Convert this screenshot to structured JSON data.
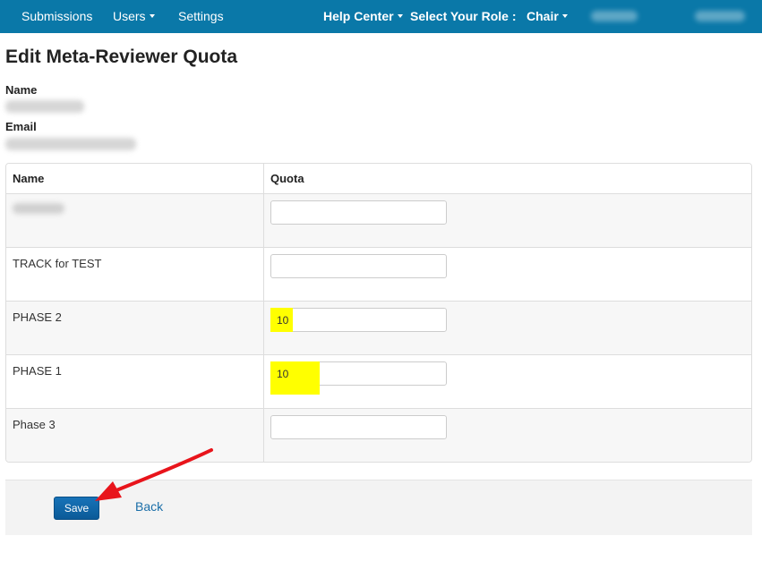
{
  "navbar": {
    "submissions": "Submissions",
    "users": "Users",
    "settings": "Settings",
    "help_center": "Help Center",
    "select_role_label": "Select Your Role :",
    "role": "Chair"
  },
  "page": {
    "title": "Edit Meta-Reviewer Quota",
    "name_label": "Name",
    "email_label": "Email"
  },
  "table": {
    "headers": {
      "name": "Name",
      "quota": "Quota"
    },
    "rows": [
      {
        "name": "",
        "quota": ""
      },
      {
        "name": "TRACK for TEST",
        "quota": ""
      },
      {
        "name": "PHASE 2",
        "quota": "10"
      },
      {
        "name": "PHASE 1",
        "quota": "10"
      },
      {
        "name": "Phase 3",
        "quota": ""
      }
    ]
  },
  "actions": {
    "save_label": "Save",
    "back_label": "Back"
  },
  "colors": {
    "navbar": "#0a78a8",
    "highlight": "#ffff00",
    "save_button": "#1773b8",
    "annotation_arrow": "#e8141b"
  }
}
